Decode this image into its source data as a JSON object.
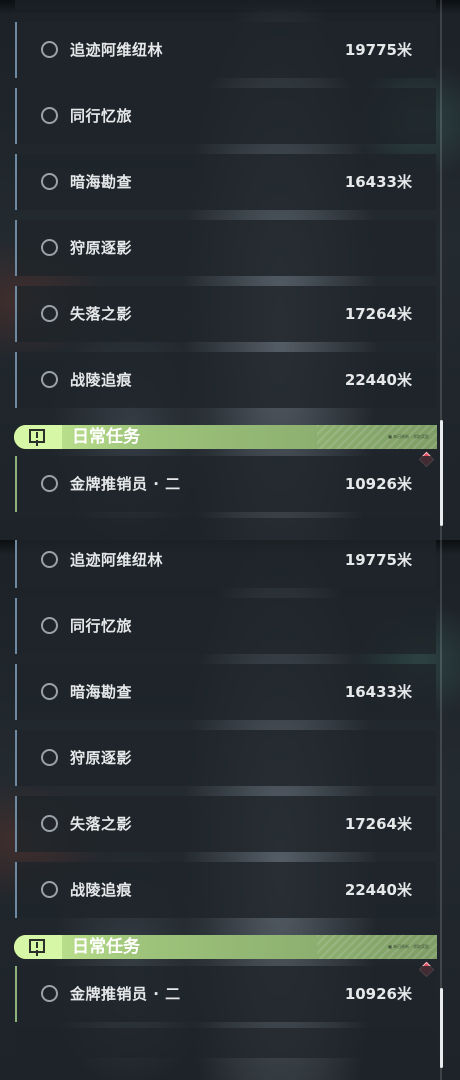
{
  "panels": [
    {
      "items": [
        {
          "name": "追迹阿维纽林",
          "distance": "19775米"
        },
        {
          "name": "同行忆旅",
          "distance": ""
        },
        {
          "name": "暗海勘查",
          "distance": "16433米"
        },
        {
          "name": "狩原逐影",
          "distance": ""
        },
        {
          "name": "失落之影",
          "distance": "17264米"
        },
        {
          "name": "战陵追痕",
          "distance": "22440米"
        }
      ],
      "section": {
        "title": "日常任务",
        "tiny_text": "■ 每日刷新 · 领取奖励"
      },
      "daily": {
        "name": "金牌推销员 · 二",
        "distance": "10926米"
      }
    },
    {
      "items": [
        {
          "name": "追迹阿维纽林",
          "distance": "19775米"
        },
        {
          "name": "同行忆旅",
          "distance": ""
        },
        {
          "name": "暗海勘查",
          "distance": "16433米"
        },
        {
          "name": "狩原逐影",
          "distance": ""
        },
        {
          "name": "失落之影",
          "distance": "17264米"
        },
        {
          "name": "战陵追痕",
          "distance": "22440米"
        }
      ],
      "section": {
        "title": "日常任务",
        "tiny_text": "■ 每日刷新 · 领取奖励"
      },
      "daily": {
        "name": "金牌推销员 · 二",
        "distance": "10926米"
      }
    }
  ],
  "icons": {
    "quest_radio": "circle-icon",
    "daily_quest": "exclamation-box-icon",
    "tracked_marker": "diamond-marker-icon"
  },
  "colors": {
    "accent_green": "#9ec47b",
    "marker_red": "#e24858",
    "list_border": "#6f8aa0"
  }
}
